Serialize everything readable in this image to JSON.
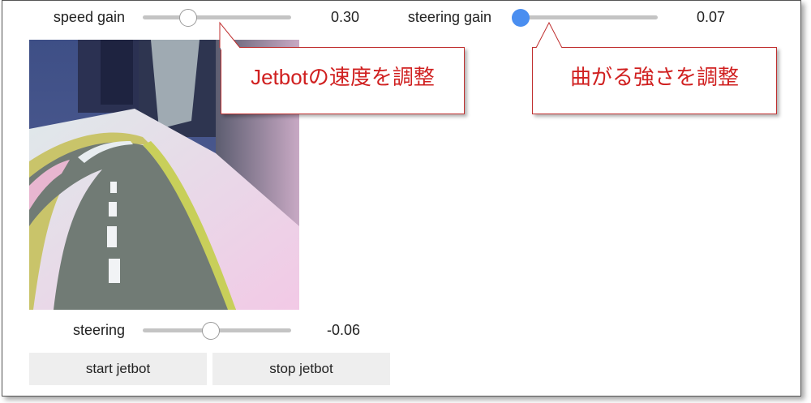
{
  "speed": {
    "label": "speed gain",
    "value": "0.30",
    "level": 0.3
  },
  "steering_gain": {
    "label": "steering gain",
    "value": "0.07",
    "level": 0.07
  },
  "steering": {
    "label": "steering",
    "value": "-0.06",
    "level": -0.06
  },
  "callouts": {
    "speed_note": "Jetbotの速度を調整",
    "steering_note": "曲がる強さを調整"
  },
  "buttons": {
    "start": "start jetbot",
    "stop": "stop jetbot"
  },
  "colors": {
    "accent": "#4a8ef0",
    "callout": "#d02020",
    "track": "#c4c4c4",
    "button_bg": "#eeeeee"
  }
}
